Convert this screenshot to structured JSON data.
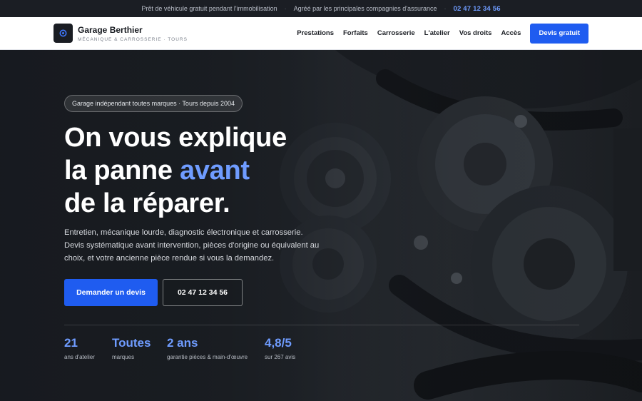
{
  "topbar": {
    "loaner": "Prêt de véhicule gratuit pendant l'immobilisation",
    "insurance": "Agréé par les principales compagnies d'assurance",
    "phone": "02 47 12 34 56"
  },
  "header": {
    "brand_name": "Garage Berthier",
    "brand_sub": "MÉCANIQUE & CARROSSERIE · TOURS",
    "nav": [
      "Prestations",
      "Forfaits",
      "Carrosserie",
      "L'atelier",
      "Vos droits",
      "Accès"
    ],
    "cta": "Devis gratuit"
  },
  "hero": {
    "badge": "Garage indépendant toutes marques · Tours depuis 2004",
    "headline_line1": "On vous explique",
    "headline_line2_a": "la panne ",
    "headline_line2_accent": "avant",
    "headline_line3": "de la réparer.",
    "lead": "Entretien, mécanique lourde, diagnostic électronique et carrosserie. Devis systématique avant intervention, pièces d'origine ou équivalent au choix, et votre ancienne pièce rendue si vous la demandez.",
    "primary_button": "Demander un devis",
    "secondary_button": "02 47 12 34 56"
  },
  "stats": [
    {
      "value": "21",
      "label": "ans d'atelier"
    },
    {
      "value": "Toutes",
      "label": "marques"
    },
    {
      "value": "2 ans",
      "label": "garantie pièces & main-d'œuvre"
    },
    {
      "value": "4,8/5",
      "label": "sur 267 avis"
    }
  ],
  "colors": {
    "accent": "#1f5cf0",
    "accent_light": "#6f9cff",
    "topbar_bg": "#1b1e24",
    "hero_bg": "#1e2227"
  },
  "icons": {
    "logo": "wrench-gear-icon"
  }
}
